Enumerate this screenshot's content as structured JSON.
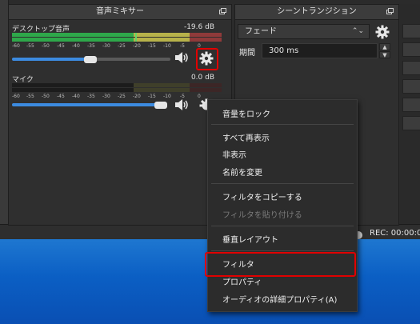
{
  "mixer": {
    "title": "音声ミキサー",
    "channels": [
      {
        "name": "デスクトップ音声",
        "db": "-19.6 dB",
        "volume_fraction": 0.52
      },
      {
        "name": "マイク",
        "db": "0.0 dB",
        "volume_fraction": 1.0
      }
    ],
    "ticks": [
      "-60",
      "-55",
      "-50",
      "-45",
      "-40",
      "-35",
      "-30",
      "-25",
      "-20",
      "-15",
      "-10",
      "-5",
      "0"
    ]
  },
  "transition": {
    "title": "シーントランジション",
    "type": "フェード",
    "duration_label": "期間",
    "duration_value": "300 ms"
  },
  "context_menu": {
    "lock_volume": "音量をロック",
    "show_all": "すべて再表示",
    "hide": "非表示",
    "rename": "名前を変更",
    "copy_filters": "フィルタをコピーする",
    "paste_filters": "フィルタを貼り付ける",
    "vertical_layout": "垂直レイアウト",
    "filters": "フィルタ",
    "properties": "プロパティ",
    "advanced_audio": "オーディオの詳細プロパティ(A)"
  },
  "status": {
    "rec": "REC: 00:00:0"
  },
  "colors": {
    "highlight": "#e00000",
    "slider": "#3c8be0",
    "meter_green": "#2ea84a"
  }
}
